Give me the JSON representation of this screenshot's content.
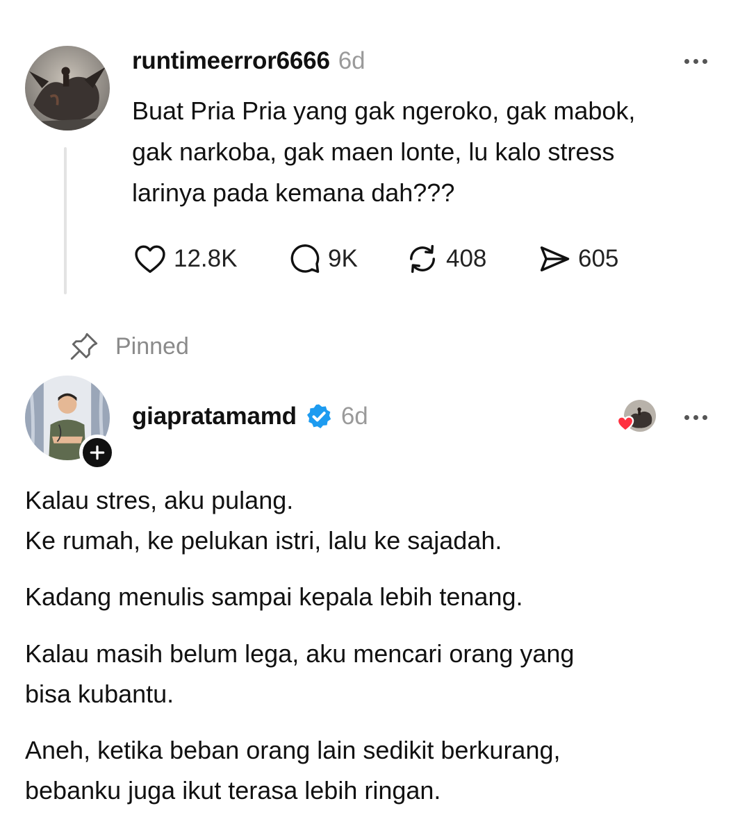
{
  "colors": {
    "text": "#111111",
    "muted": "#9a9a9a",
    "verified": "#1d9bf0",
    "heart": "#ff3040",
    "thread_line": "#e3e3e3"
  },
  "post": {
    "avatar_icon": "dragon-rider-avatar",
    "username": "runtimeerror6666",
    "timestamp": "6d",
    "text_lines": [
      "Buat Pria Pria yang gak ngeroko, gak mabok,",
      "gak narkoba, gak maen lonte, lu kalo stress",
      "larinya pada kemana dah???"
    ],
    "stats": {
      "likes": "12.8K",
      "replies": "9K",
      "reposts": "408",
      "shares": "605"
    }
  },
  "pinned_label": "Pinned",
  "reply": {
    "avatar_icon": "doctor-avatar",
    "username": "giapratamamd",
    "timestamp": "6d",
    "paragraphs": [
      [
        "Kalau stres, aku pulang.",
        "Ke rumah, ke pelukan istri, lalu ke sajadah."
      ],
      [
        "Kadang menulis sampai kepala lebih tenang."
      ],
      [
        "Kalau masih belum lega, aku mencari orang yang",
        "bisa kubantu."
      ],
      [
        "Aneh, ketika beban orang lain sedikit berkurang,",
        "bebanku juga ikut terasa lebih ringan."
      ]
    ]
  }
}
